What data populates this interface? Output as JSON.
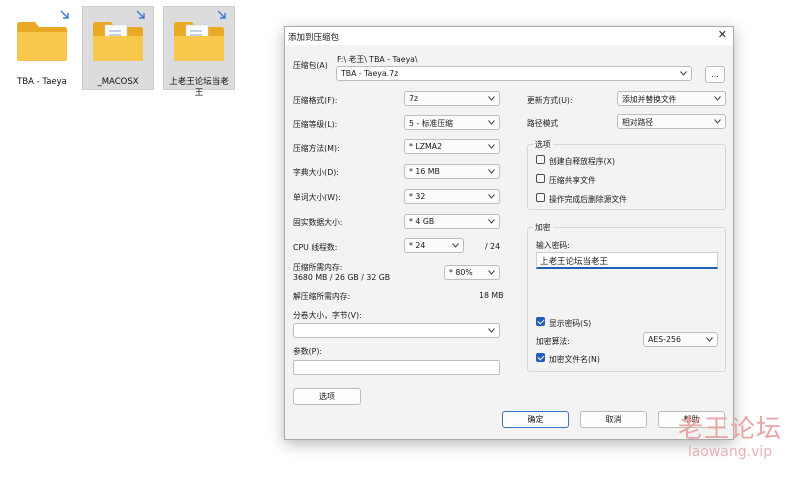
{
  "desktop": {
    "folders": [
      {
        "name": "TBA - Taeya",
        "icon": "folder-icon"
      },
      {
        "name": "_MACOSX",
        "icon": "folder-with-files-icon"
      },
      {
        "name": "上老王论坛当老王",
        "icon": "folder-with-files-icon"
      }
    ]
  },
  "dialog": {
    "title": "添加到压缩包",
    "close_glyph": "✕",
    "archive": {
      "label": "压缩包(A)",
      "path": "F:\\ 老王\\ TBA - Taeya\\",
      "filename": "TBA - Taeya.7z",
      "browse_label": "..."
    },
    "left": {
      "format_label": "压缩格式(F):",
      "format_value": "7z",
      "level_label": "压缩等级(L):",
      "level_value": "5 - 标准压缩",
      "method_label": "压缩方法(M):",
      "method_value": "* LZMA2",
      "dict_label": "字典大小(D):",
      "dict_value": "* 16 MB",
      "word_label": "单词大小(W):",
      "word_value": "* 32",
      "solid_label": "固实数据大小:",
      "solid_value": "* 4 GB",
      "threads_label": "CPU 线程数:",
      "threads_value": "* 24",
      "threads_total": "/ 24",
      "mem_label": "压缩所需内存:",
      "mem_value": "3680 MB / 26 GB / 32 GB",
      "mem_percent": "* 80%",
      "decomp_label": "解压缩所需内存:",
      "decomp_value": "18 MB",
      "split_label": "分卷大小，字节(V):",
      "split_value": "",
      "params_label": "参数(P):",
      "params_value": "",
      "options_button": "选项"
    },
    "right": {
      "update_label": "更新方式(U):",
      "update_value": "添加并替换文件",
      "path_label": "路径模式",
      "path_value": "相对路径",
      "options_group": "选项",
      "opt_sfx": "创建自释放程序(X)",
      "opt_shared": "压缩共享文件",
      "opt_delete": "操作完成后删除源文件",
      "encrypt_group": "加密",
      "password_label": "输入密码:",
      "password_value": "上老王论坛当老王",
      "show_password": "显示密码(S)",
      "algo_label": "加密算法:",
      "algo_value": "AES-256",
      "encrypt_names": "加密文件名(N)"
    },
    "buttons": {
      "ok": "确定",
      "cancel": "取消",
      "help": "帮助"
    }
  },
  "watermark": {
    "line1": "老王论坛",
    "line2": "laowang.vip"
  },
  "colors": {
    "accent": "#1f5fb8",
    "folder": "#f5c242",
    "watermark": "#e9a4a4"
  }
}
